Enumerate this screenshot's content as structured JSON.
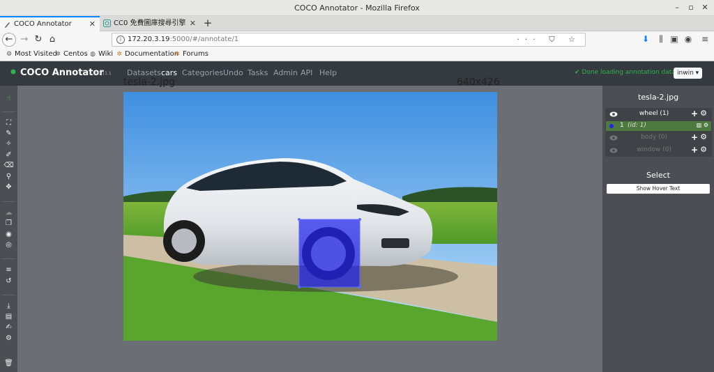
{
  "window": {
    "title": "COCO Annotator - Mozilla Firefox",
    "controls": [
      "–",
      "▫",
      "✕"
    ]
  },
  "tabs": [
    {
      "label": "COCO Annotator",
      "active": true
    },
    {
      "label": "CC0 免費圖庫搜尋引擎",
      "active": false
    }
  ],
  "browser": {
    "url_host": "172.20.3.19",
    "url_rest": ":5000/#/annotate/1",
    "url_actions": "··· ⛉ ☆"
  },
  "bookmarks": [
    {
      "label": "Most Visited",
      "icon": "gear-icon"
    },
    {
      "label": "Centos",
      "icon": "centos-icon"
    },
    {
      "label": "Wiki",
      "icon": "globe-icon"
    },
    {
      "label": "Documentation",
      "icon": "bookmark-icon"
    },
    {
      "label": "Forums",
      "icon": "bookmark-icon"
    }
  ],
  "app": {
    "brand": "COCO Annotator",
    "version": "v0.11.1",
    "nav": [
      "Datasets",
      "cars",
      "Categories",
      "Undo",
      "Tasks",
      "Admin",
      "API",
      "Help"
    ],
    "status": "✔ Done loading annotation data",
    "user": "inwin ▾",
    "accent": "#2fb34a"
  },
  "canvas": {
    "file_name": "tesla-2.jpg",
    "image_size": "640x426"
  },
  "panel": {
    "title": "tesla-2.jpg",
    "categories": [
      {
        "name": "wheel (1)",
        "enabled": true
      },
      {
        "name": "body (0)",
        "enabled": false
      },
      {
        "name": "window (0)",
        "enabled": false
      }
    ],
    "annotation": {
      "id": "1",
      "tag": "(id: 1)",
      "color": "#2222ee"
    },
    "select_label": "Select",
    "hover_button": "Show Hover Text"
  }
}
